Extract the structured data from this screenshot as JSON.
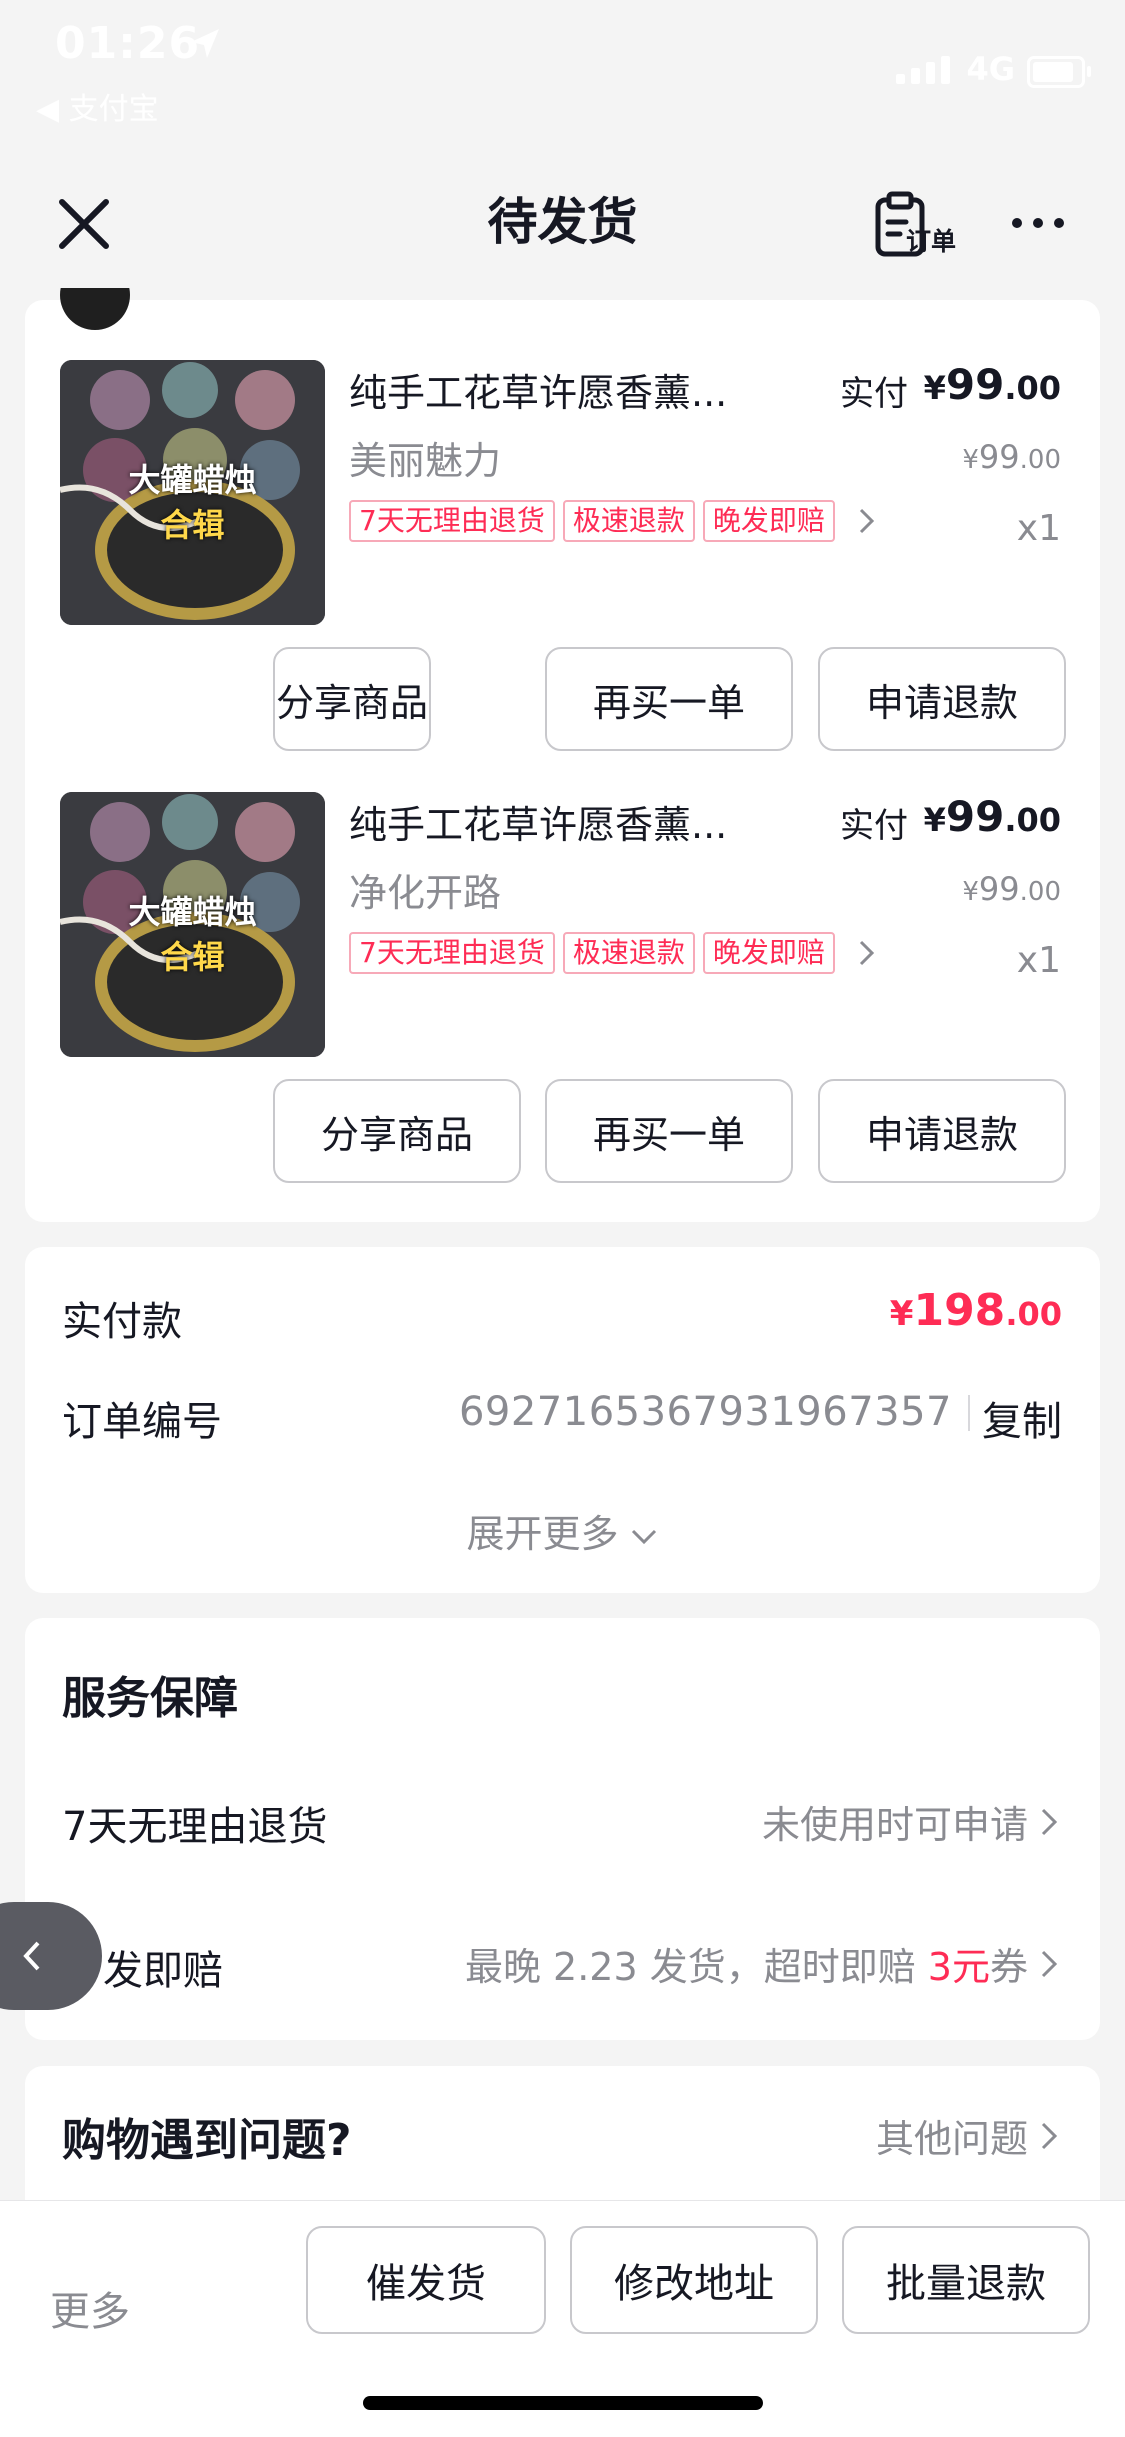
{
  "status_bar": {
    "time": "01:26",
    "back_app": "◀ 支付宝",
    "network": "4G"
  },
  "nav": {
    "title": "待发货",
    "order_label": "订单"
  },
  "colors": {
    "accent": "#fe2c55",
    "background": "#f4f4f4",
    "text": "#161823",
    "muted": "#8a8b91"
  },
  "products": [
    {
      "image_text_1": "大罐蜡烛",
      "image_text_2": "合辑",
      "name": "纯手工花草许愿香薰...",
      "variant": "美丽魅力",
      "paid_label": "实付",
      "paid_symbol": "¥",
      "paid_int": "99",
      "paid_dec": ".00",
      "orig_symbol": "¥",
      "orig_int": "99",
      "orig_dec": ".00",
      "tags": [
        "7天无理由退货",
        "极速退款",
        "晚发即赔"
      ],
      "quantity": "x1",
      "buttons": [
        "分享商品",
        "再买一单",
        "申请退款"
      ]
    },
    {
      "image_text_1": "大罐蜡烛",
      "image_text_2": "合辑",
      "name": "纯手工花草许愿香薰...",
      "variant": "净化开路",
      "paid_label": "实付",
      "paid_symbol": "¥",
      "paid_int": "99",
      "paid_dec": ".00",
      "orig_symbol": "¥",
      "orig_int": "99",
      "orig_dec": ".00",
      "tags": [
        "7天无理由退货",
        "极速退款",
        "晚发即赔"
      ],
      "quantity": "x1",
      "buttons": [
        "分享商品",
        "再买一单",
        "申请退款"
      ]
    }
  ],
  "summary": {
    "paid_label": "实付款",
    "paid_symbol": "¥",
    "paid_int": "198",
    "paid_dec": ".00",
    "order_no_label": "订单编号",
    "order_no": "6927165367931967357",
    "copy_label": "复制",
    "expand_label": "展开更多"
  },
  "service": {
    "title": "服务保障",
    "rows": [
      {
        "label": "7天无理由退货",
        "value": "未使用时可申请"
      },
      {
        "label": "发即赔",
        "value_prefix": "最晚 2.23 发货，超时即赔 ",
        "value_highlight": "3元",
        "value_suffix": "券"
      }
    ]
  },
  "help": {
    "title": "购物遇到问题?",
    "link": "其他问题"
  },
  "bottom_bar": {
    "more_label": "更多",
    "buttons": [
      "催发货",
      "修改地址",
      "批量退款"
    ]
  }
}
